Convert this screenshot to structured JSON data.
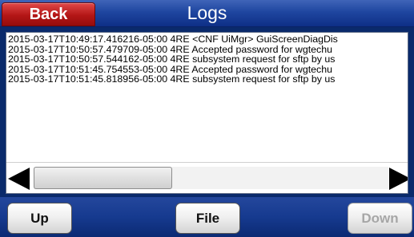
{
  "header": {
    "back_label": "Back",
    "title": "Logs"
  },
  "log": {
    "lines": [
      "2015-03-17T10:49:17.416216-05:00 4RE <CNF UiMgr> GuiScreenDiagDis",
      "2015-03-17T10:50:57.479709-05:00 4RE Accepted password for wgtechu",
      "2015-03-17T10:50:57.544162-05:00 4RE subsystem request for sftp by us",
      "2015-03-17T10:51:45.754553-05:00 4RE Accepted password for wgtechu",
      "2015-03-17T10:51:45.818956-05:00 4RE subsystem request for sftp by us"
    ]
  },
  "footer": {
    "up_label": "Up",
    "file_label": "File",
    "down_label": "Down",
    "down_enabled": false
  },
  "colors": {
    "header_blue": "#1f46a0",
    "back_red": "#b31616",
    "footer_blue": "#163a8f"
  }
}
